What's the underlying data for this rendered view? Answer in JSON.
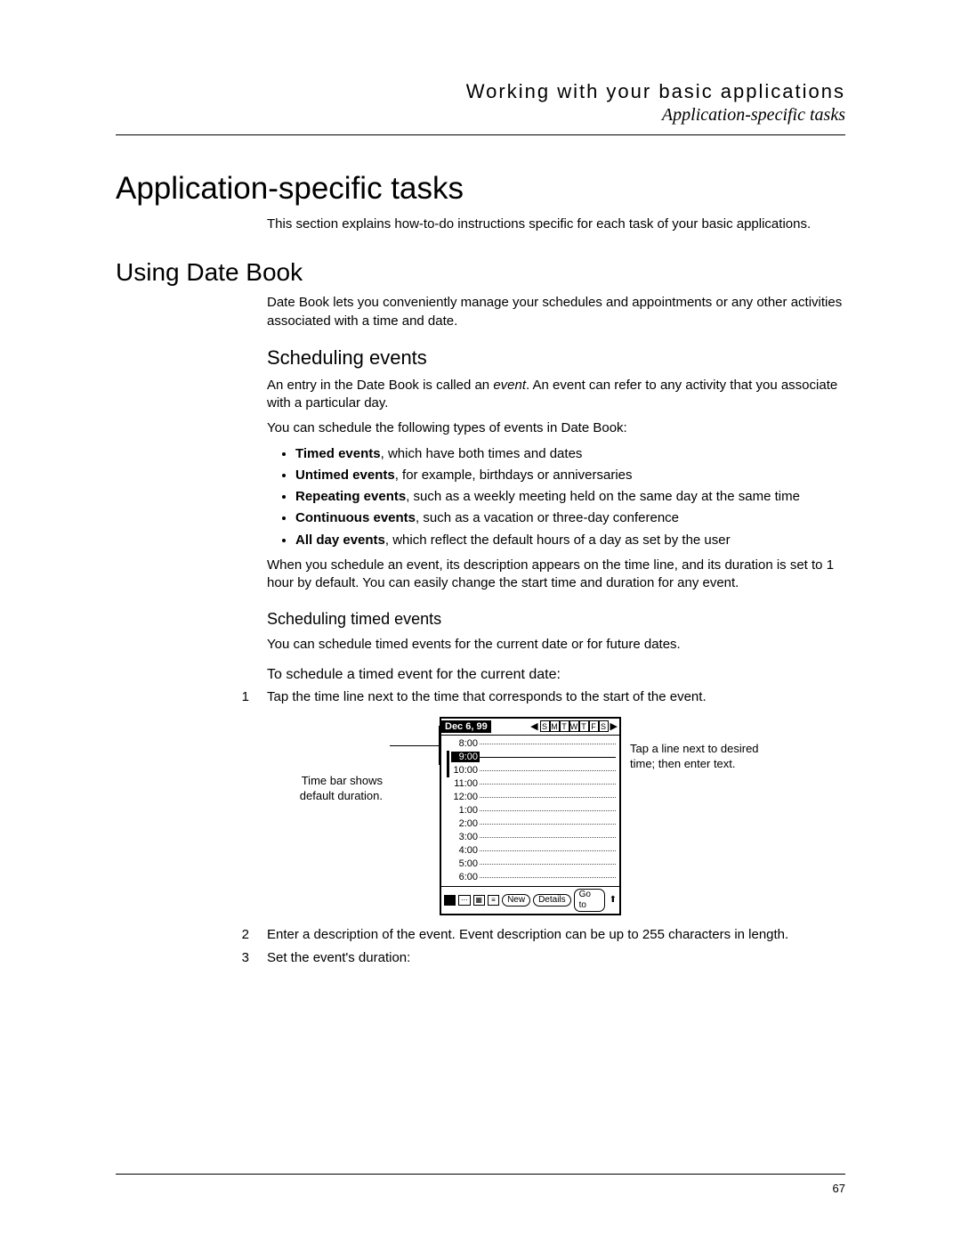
{
  "header": {
    "title": "Working with your basic applications",
    "subtitle": "Application-specific tasks"
  },
  "h1": "Application-specific tasks",
  "intro": "This section explains how-to-do instructions specific for each task of your basic applications.",
  "h2": "Using Date Book",
  "datebook_intro": "Date Book lets you conveniently manage your schedules and appointments or any other activities associated with a time and date.",
  "h3_sched": "Scheduling events",
  "sched_p1_a": "An entry in the Date Book is called an ",
  "sched_p1_em": "event",
  "sched_p1_b": ". An event can refer to any activity that you associate with a particular day.",
  "sched_p2": "You can schedule the following types of events in Date Book:",
  "bullets": [
    {
      "b": "Timed events",
      "rest": ", which have both times and dates"
    },
    {
      "b": "Untimed events",
      "rest": ", for example, birthdays or anniversaries"
    },
    {
      "b": "Repeating events",
      "rest": ", such as a weekly meeting held on the same day at the same time"
    },
    {
      "b": "Continuous events",
      "rest": ", such as a vacation or three-day conference"
    },
    {
      "b": "All day events",
      "rest": ", which reflect the default hours of a day as set by the user"
    }
  ],
  "sched_p3": "When you schedule an event, its description appears on the time line, and its duration is set to 1 hour by default. You can easily change the start time and duration for any event.",
  "h4_timed": "Scheduling timed events",
  "timed_p1": "You can schedule timed events for the current date or for future dates.",
  "lead_current": "To schedule a timed event for the current date:",
  "steps": [
    {
      "n": "1",
      "t": "Tap the time line next to the time that corresponds to the start of the event."
    },
    {
      "n": "2",
      "t": "Enter a description of the event. Event description can be up to 255 characters in length."
    },
    {
      "n": "3",
      "t": "Set the event's duration:"
    }
  ],
  "fig": {
    "date": "Dec 6, 99",
    "days": [
      "S",
      "M",
      "T",
      "W",
      "T",
      "F",
      "S"
    ],
    "times": [
      "8:00",
      "9:00",
      "10:00",
      "11:00",
      "12:00",
      "1:00",
      "2:00",
      "3:00",
      "4:00",
      "5:00",
      "6:00"
    ],
    "sel_index": 1,
    "btn_new": "New",
    "btn_details": "Details",
    "btn_goto": "Go to",
    "left_label_1": "Time bar shows",
    "left_label_2": "default duration.",
    "right_label_1": "Tap a line next to desired",
    "right_label_2": "time; then enter text."
  },
  "page_number": "67"
}
